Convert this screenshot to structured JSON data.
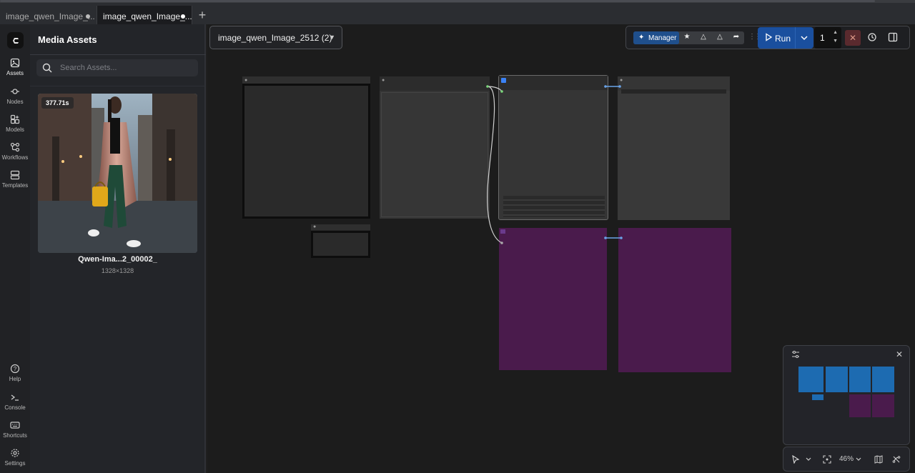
{
  "tabs": [
    {
      "label": "image_qwen_Image_..."
    },
    {
      "label": "image_qwen_Image_..."
    }
  ],
  "rail": {
    "items": [
      {
        "label": "Assets",
        "icon": "image-icon"
      },
      {
        "label": "Nodes",
        "icon": "nodes-icon"
      },
      {
        "label": "Models",
        "icon": "models-icon"
      },
      {
        "label": "Workflows",
        "icon": "workflows-icon"
      },
      {
        "label": "Templates",
        "icon": "templates-icon"
      }
    ],
    "bottom": [
      {
        "label": "Help",
        "icon": "help-icon"
      },
      {
        "label": "Console",
        "icon": "console-icon"
      },
      {
        "label": "Shortcuts",
        "icon": "keyboard-icon"
      },
      {
        "label": "Settings",
        "icon": "gear-icon"
      }
    ]
  },
  "panel": {
    "title": "Media Assets",
    "search_placeholder": "Search Assets...",
    "asset": {
      "badge": "377.71s",
      "name": "Qwen-Ima...2_00002_",
      "dimensions": "1328×1328"
    }
  },
  "workflow": {
    "name": "image_qwen_Image_2512 (2)"
  },
  "toolbar": {
    "manager_label": "Manager",
    "run_label": "Run",
    "queue_count": "1"
  },
  "zoom": {
    "level": "46%"
  },
  "colors": {
    "accent": "#1a4f9e",
    "node_gray": "#353535",
    "node_purple": "#4a1b4c",
    "minimap_blue": "#1d6bb1"
  }
}
